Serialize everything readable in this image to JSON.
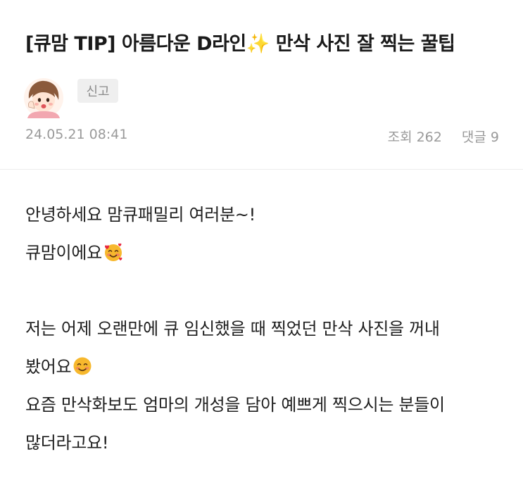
{
  "post": {
    "title": "[큐맘 TIP] 아름다운 D라인✨ 만삭 사진 잘 찍는 꿀팁",
    "report_label": "신고",
    "date": "24.05.21 08:41",
    "views_label": "조회 262",
    "comments_label": "댓글 9"
  },
  "body": {
    "greeting": "안녕하세요 맘큐패밀리 여러분~!",
    "intro": "큐맘이에요",
    "para2_line1": "저는 어제 오랜만에 큐 임신했을 때 찍었던 만삭 사진을 꺼내",
    "para2_line2": "봤어요",
    "para3_line1": "요즘 만삭화보도 엄마의 개성을 담아 예쁘게 찍으시는 분들이",
    "para3_line2": "많더라고요!"
  },
  "icons": {
    "avatar": "cartoon-mom-avatar",
    "intro_emoji": "smiling-face-with-hearts",
    "para2_emoji": "smiling-face"
  },
  "colors": {
    "meta_text": "#9a9a9a",
    "report_bg": "#efefef",
    "divider": "#ececec"
  }
}
